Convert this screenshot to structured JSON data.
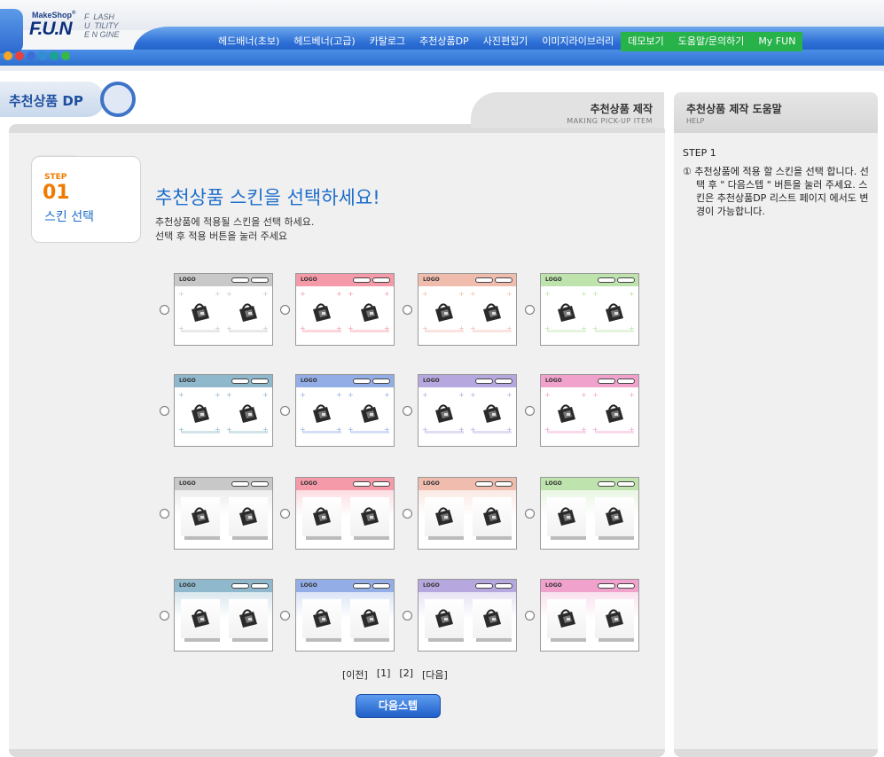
{
  "logo": {
    "makeshop": "MakeShop",
    "reg": "®",
    "fun": "F.U.N",
    "side_line1": "F  LASH",
    "side_line2": "U  TILITY",
    "side_line3": "E N GINE"
  },
  "nav": [
    {
      "label": "헤드배너(초보)",
      "highlight": false
    },
    {
      "label": "헤드베너(고급)",
      "highlight": false
    },
    {
      "label": "카탈로그",
      "highlight": false
    },
    {
      "label": "추천상품DP",
      "highlight": false
    },
    {
      "label": "사진편집기",
      "highlight": false
    },
    {
      "label": "이미지라이브러리",
      "highlight": false
    },
    {
      "label": "데모보기",
      "highlight": true
    },
    {
      "label": "도움말/문의하기",
      "highlight": true
    },
    {
      "label": "My FUN",
      "highlight": true
    }
  ],
  "dots": [
    "#f5a623",
    "#e8413c",
    "#3b6fd6",
    "#2f8fd0",
    "#1aa38e",
    "#35b84a"
  ],
  "page_title": "추천상품 DP",
  "main": {
    "tab_title": "추천상품 제작",
    "tab_sub": "MAKING PICK-UP ITEM",
    "step_label": "STEP",
    "step_num": "01",
    "step_name": "스킨 선택",
    "headline": "추천상품 스킨을 선택하세요!",
    "sub1": "추천상품에 적용될 스킨을 선택 하세요.",
    "sub2": "선택 후 적용 버튼을 눌러 주세요"
  },
  "skins": {
    "logo_text": "LOGO",
    "colors": [
      "#c8c8c8",
      "#f59aa8",
      "#f0bcae",
      "#bfe3ad",
      "#8fb8cc",
      "#93aee6",
      "#b6a8de",
      "#f0a2cc"
    ],
    "rows": [
      {
        "style": "grid"
      },
      {
        "style": "grid"
      },
      {
        "style": "shelf"
      },
      {
        "style": "shelf"
      }
    ]
  },
  "pager": {
    "prev": "[이전]",
    "page1": "[1]",
    "page2": "[2]",
    "next": "[다음]"
  },
  "next_step_button": "다음스텝",
  "help": {
    "title": "추천상품 제작 도움말",
    "sub": "HELP",
    "step": "STEP 1",
    "text": "① 추천상품에 적용 할 스킨을 선택 합니다. 선택 후 \" 다음스텝 \" 버튼을 눌러 주세요. 스킨은 추천상품DP 리스트 페이지 에서도 변경이 가능합니다."
  }
}
